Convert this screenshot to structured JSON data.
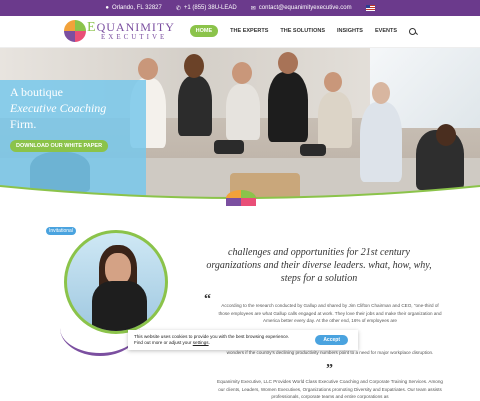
{
  "topbar": {
    "location": "Orlando, FL 32827",
    "phone": "+1 (855) 38U-LEAD",
    "email": "contact@equanimityexecutive.com"
  },
  "logo": {
    "word_prefix": "Q",
    "word_rest": "UANIMITY",
    "sub": "EXECUTIVE",
    "big_letter": "E"
  },
  "nav": {
    "items": [
      "HOME",
      "THE EXPERTS",
      "THE SOLUTIONS",
      "INSIGHTS",
      "EVENTS"
    ]
  },
  "hero": {
    "line1": "A boutique",
    "line2": "Executive Coaching",
    "line3": "Firm.",
    "button": "DOWNLOAD OUR WHITE PAPER"
  },
  "content": {
    "badge": "Invitational",
    "heading": "challenges and opportunities for 21st century organizations and their diverse leaders. what, how, why, steps for a solution",
    "para1": "According to the research conducted by Gallup and shared by Jim Clifton Chairman and CEO, \"one-third of those employees are what Gallup calls engaged at work. They love their jobs and make their organization and America better every day. At the other end, 16% of employees are",
    "para2": "wonders if the country's declining productivity numbers point to a need for major workplace disruption.",
    "para3": "Equanimity Executive, LLC Provides World Class Executive Coaching and Corporate Training Services. Among our clients, Leaders, Women Executives, Organizations promoting Diversity and Expatriates. Our team assists professionals, corporate teams and entire corporations as"
  },
  "cookie": {
    "line1": "This website uses cookies to provide you with the best browsing experience.",
    "line2_prefix": "Find out more or adjust your ",
    "line2_link": "settings",
    "button": "Accept"
  },
  "colors": {
    "purple": "#6b3a8c",
    "green": "#8bc34a",
    "blue": "#4aa3df"
  }
}
